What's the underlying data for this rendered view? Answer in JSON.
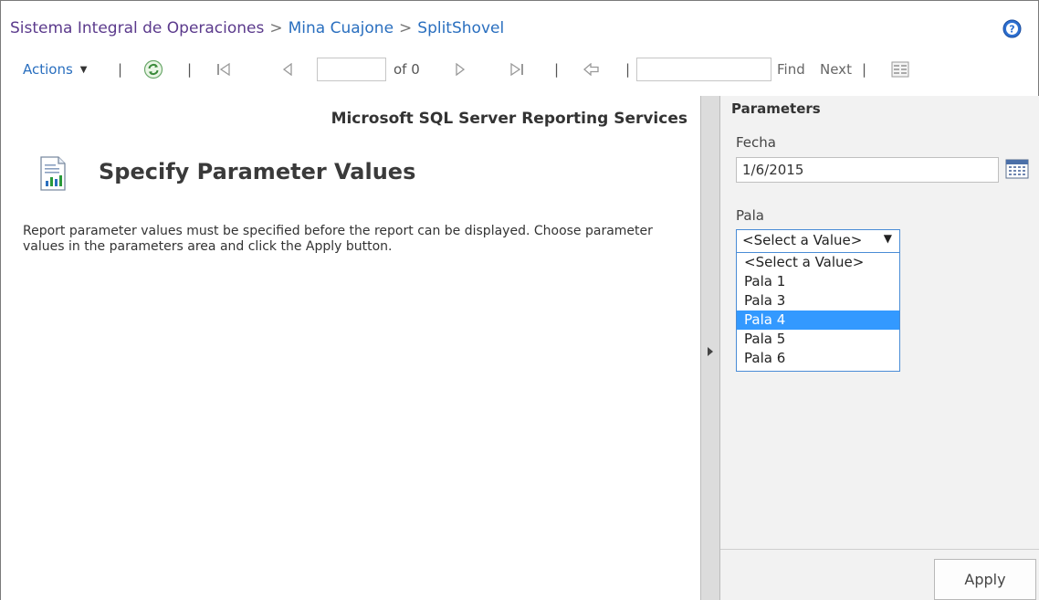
{
  "breadcrumb": {
    "items": [
      "Sistema Integral de Operaciones",
      "Mina Cuajone",
      "SplitShovel"
    ],
    "separator": ">"
  },
  "icons": {
    "help": "help-icon",
    "refresh": "refresh-icon",
    "first_page": "first-page-icon",
    "prev_page": "prev-page-icon",
    "next_page": "next-page-icon",
    "last_page": "last-page-icon",
    "back": "back-icon",
    "doc_map": "document-map-icon",
    "report": "report-doc-icon",
    "calendar": "calendar-icon"
  },
  "toolbar": {
    "actions_label": "Actions",
    "page_current": "",
    "page_of_label": "of 0",
    "find_value": "",
    "find_label": "Find",
    "next_label": "Next"
  },
  "report": {
    "service_title": "Microsoft SQL Server Reporting Services",
    "heading": "Specify Parameter Values",
    "instruction": "Report parameter values must be specified before the report can be displayed. Choose parameter values in the parameters area and click the Apply button."
  },
  "parameters": {
    "header": "Parameters",
    "fecha_label": "Fecha",
    "fecha_value": "1/6/2015",
    "pala_label": "Pala",
    "pala_selected": "<Select a Value>",
    "pala_options": [
      "<Select a Value>",
      "Pala 1",
      "Pala 3",
      "Pala 4",
      "Pala 5",
      "Pala 6"
    ],
    "pala_highlighted": "Pala 4",
    "apply_label": "Apply"
  },
  "colors": {
    "link": "#2a6fbf",
    "visited_link": "#5b3a8c",
    "highlight": "#3399ff",
    "panel_bg": "#f2f2f2"
  }
}
